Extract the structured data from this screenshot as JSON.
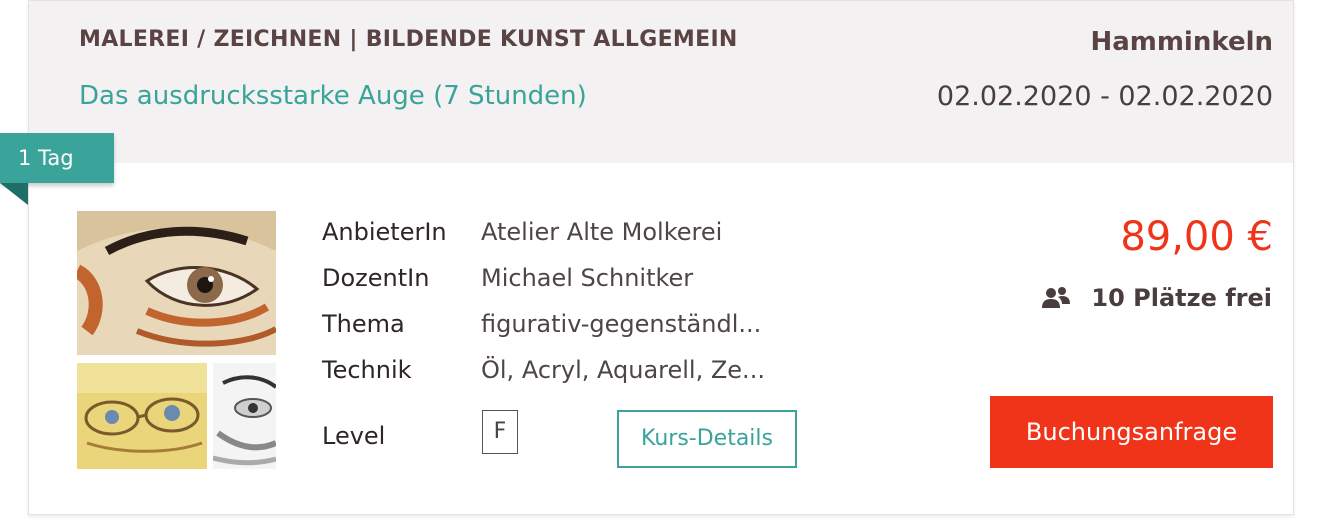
{
  "course": {
    "category": "MALEREI / ZEICHNEN | BILDENDE KUNST ALLGEMEIN",
    "title": "Das ausdrucksstarke Auge (7 Stunden)",
    "city": "Hamminkeln",
    "dates": "02.02.2020 - 02.02.2020",
    "duration_badge": "1 Tag"
  },
  "details": {
    "provider_label": "AnbieterIn",
    "provider_value": "Atelier Alte Molkerei",
    "teacher_label": "DozentIn",
    "teacher_value": "Michael Schnitker",
    "theme_label": "Thema",
    "theme_value": "figurativ-gegenständl...",
    "technique_label": "Technik",
    "technique_value": "Öl, Acryl, Aquarell, Ze...",
    "level_label": "Level",
    "level_value": "F",
    "details_button": "Kurs-Details"
  },
  "booking": {
    "price": "89,00 €",
    "seats": "10 Plätze frei",
    "seats_icon": "group-icon",
    "book_button": "Buchungsanfrage"
  },
  "colors": {
    "accent": "#3aa39a",
    "price": "#f0341a",
    "header_bg": "#f3f1f2"
  }
}
